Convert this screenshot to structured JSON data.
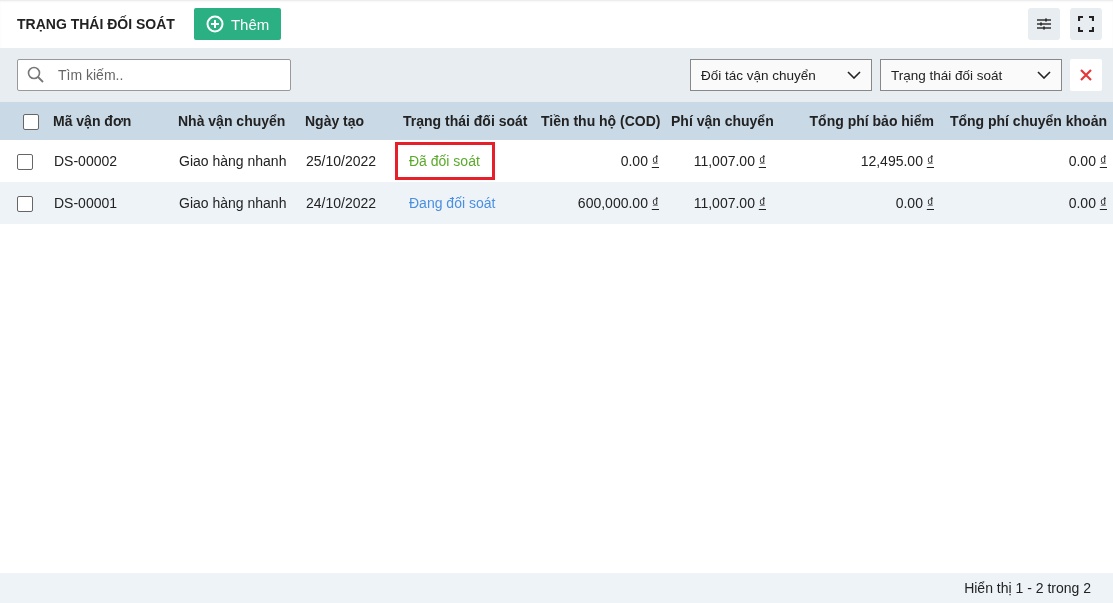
{
  "header": {
    "title": "TRẠNG THÁI ĐỐI SOÁT",
    "add_button": "Thêm"
  },
  "filters": {
    "search": {
      "placeholder": "Tìm kiếm.."
    },
    "dropdowns": [
      {
        "label": "Đối tác vận chuyển"
      },
      {
        "label": "Trạng thái đối soát"
      }
    ]
  },
  "table": {
    "columns": [
      "Mã vận đơn",
      "Nhà vận chuyển",
      "Ngày tạo",
      "Trạng thái đối soát",
      "Tiền thu hộ (COD)",
      "Phí vận chuyển",
      "Tổng phí bảo hiểm",
      "Tổng phí chuyển khoản"
    ],
    "rows": [
      {
        "checked": false,
        "code": "DS-00002",
        "carrier": "Giao hàng nhanh",
        "date": "25/10/2022",
        "status": {
          "label": "Đã đối soát",
          "kind": "done",
          "highlighted": true
        },
        "amounts": [
          {
            "value": "0.00",
            "currency": "₫"
          },
          {
            "value": "11,007.00",
            "currency": "₫"
          },
          {
            "value": "12,495.00",
            "currency": "₫"
          },
          {
            "value": "0.00",
            "currency": "₫"
          }
        ]
      },
      {
        "checked": false,
        "code": "DS-00001",
        "carrier": "Giao hàng nhanh",
        "date": "24/10/2022",
        "status": {
          "label": "Đang đối soát",
          "kind": "pending",
          "highlighted": false
        },
        "amounts": [
          {
            "value": "600,000.00",
            "currency": "₫"
          },
          {
            "value": "11,007.00",
            "currency": "₫"
          },
          {
            "value": "0.00",
            "currency": "₫"
          },
          {
            "value": "0.00",
            "currency": "₫"
          }
        ]
      }
    ],
    "select_all_checked": false
  },
  "footer": {
    "summary": "Hiển thị 1 - 2 trong 2"
  }
}
